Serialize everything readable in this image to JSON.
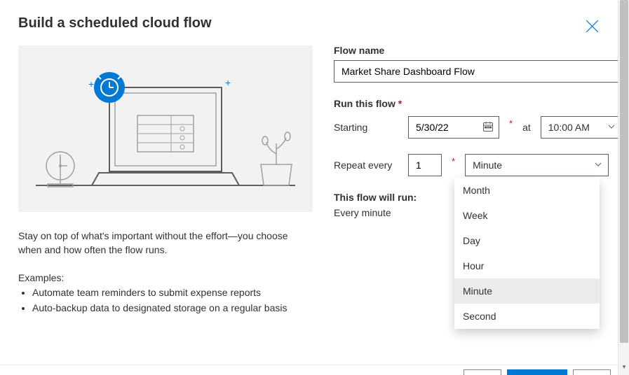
{
  "dialog": {
    "title": "Build a scheduled cloud flow",
    "description": "Stay on top of what's important without the effort—you choose when and how often the flow runs.",
    "examples_label": "Examples:",
    "examples": [
      "Automate team reminders to submit expense reports",
      "Auto-backup data to designated storage on a regular basis"
    ]
  },
  "form": {
    "flow_name_label": "Flow name",
    "flow_name_value": "Market Share Dashboard Flow",
    "run_label": "Run this flow",
    "starting_label": "Starting",
    "starting_date": "5/30/22",
    "at_label": "at",
    "starting_time": "10:00 AM",
    "repeat_label": "Repeat every",
    "repeat_count": "1",
    "repeat_unit": "Minute",
    "run_summary_label": "This flow will run:",
    "run_summary_value": "Every minute"
  },
  "dropdown": {
    "options": [
      "Month",
      "Week",
      "Day",
      "Hour",
      "Minute",
      "Second"
    ],
    "selected": "Minute"
  }
}
